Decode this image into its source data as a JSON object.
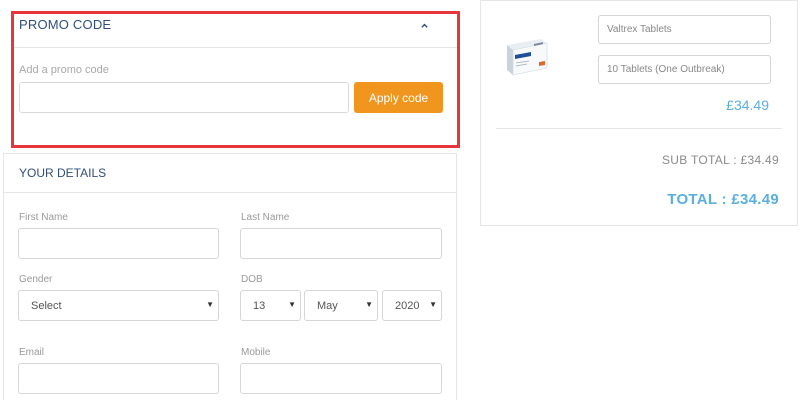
{
  "promo": {
    "title": "PROMO CODE",
    "label": "Add a promo code",
    "input_value": "",
    "input_placeholder": "",
    "apply_label": "Apply code",
    "highlight_color": "#e8343b",
    "button_color": "#f0961e"
  },
  "details": {
    "title": "YOUR DETAILS",
    "first_name_label": "First Name",
    "last_name_label": "Last Name",
    "gender_label": "Gender",
    "gender_value": "Select",
    "dob_label": "DOB",
    "dob_day": "13",
    "dob_month": "May",
    "dob_year": "2020",
    "email_label": "Email",
    "mobile_label": "Mobile"
  },
  "cart": {
    "product_name": "Valtrex Tablets",
    "product_option": "10 Tablets (One Outbreak)",
    "price": "£34.49",
    "subtotal": "SUB TOTAL : £34.49",
    "total": "TOTAL : £34.49",
    "accent_color": "#5aaee0"
  },
  "icons": {
    "collapse": "chevron-up-icon",
    "select_arrow": "caret-down-icon",
    "product": "medicine-box-image"
  }
}
